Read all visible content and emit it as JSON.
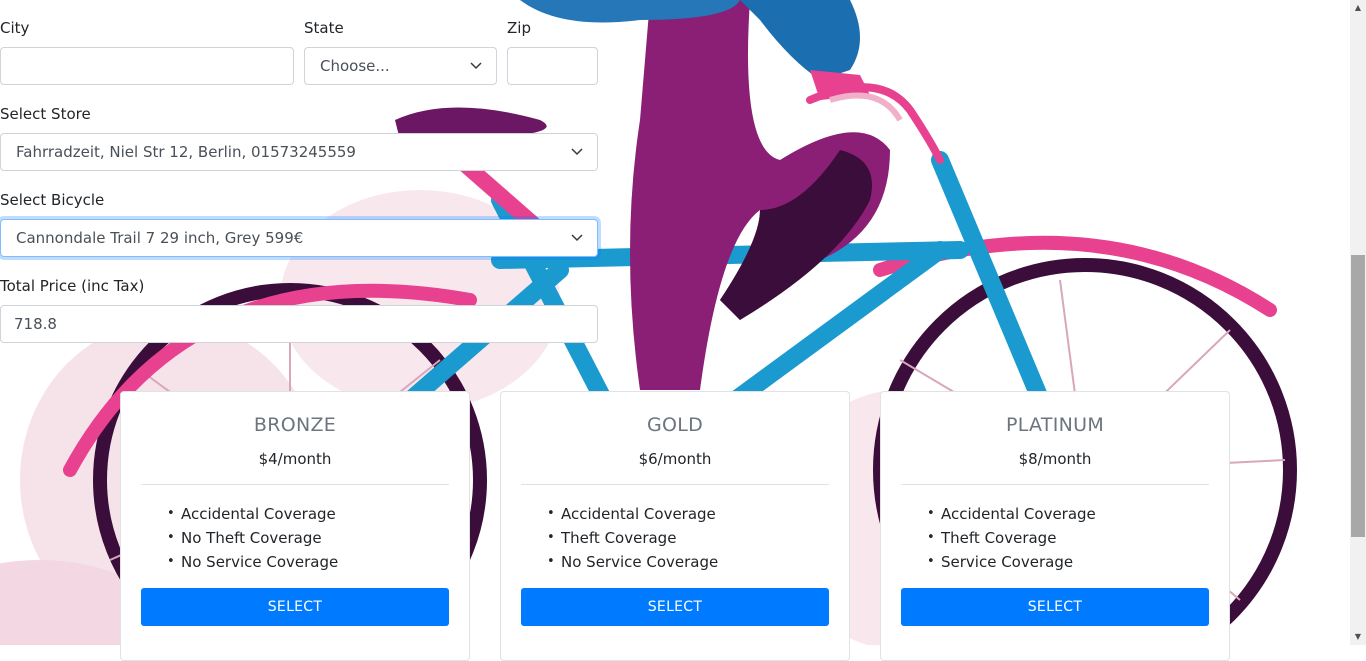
{
  "form": {
    "city": {
      "label": "City",
      "value": ""
    },
    "state": {
      "label": "State",
      "value": "Choose..."
    },
    "zip": {
      "label": "Zip",
      "value": ""
    },
    "store": {
      "label": "Select Store",
      "value": "Fahrradzeit, Niel Str 12, Berlin, 01573245559"
    },
    "bicycle": {
      "label": "Select Bicycle",
      "value": "Cannondale Trail 7 29 inch, Grey 599€"
    },
    "total": {
      "label": "Total Price (inc Tax)",
      "value": "718.8"
    }
  },
  "plans": [
    {
      "name": "BRONZE",
      "price": "$4/month",
      "features": [
        "Accidental Coverage",
        "No Theft Coverage",
        "No Service Coverage"
      ],
      "button": "SELECT"
    },
    {
      "name": "GOLD",
      "price": "$6/month",
      "features": [
        "Accidental Coverage",
        "Theft Coverage",
        "No Service Coverage"
      ],
      "button": "SELECT"
    },
    {
      "name": "PLATINUM",
      "price": "$8/month",
      "features": [
        "Accidental Coverage",
        "Theft Coverage",
        "Service Coverage"
      ],
      "button": "SELECT"
    }
  ],
  "colors": {
    "accent": "#007bff",
    "magenta": "#8b1f75",
    "pink": "#e8418f",
    "blue": "#1b9ad0",
    "dark": "#3a0d3a"
  }
}
